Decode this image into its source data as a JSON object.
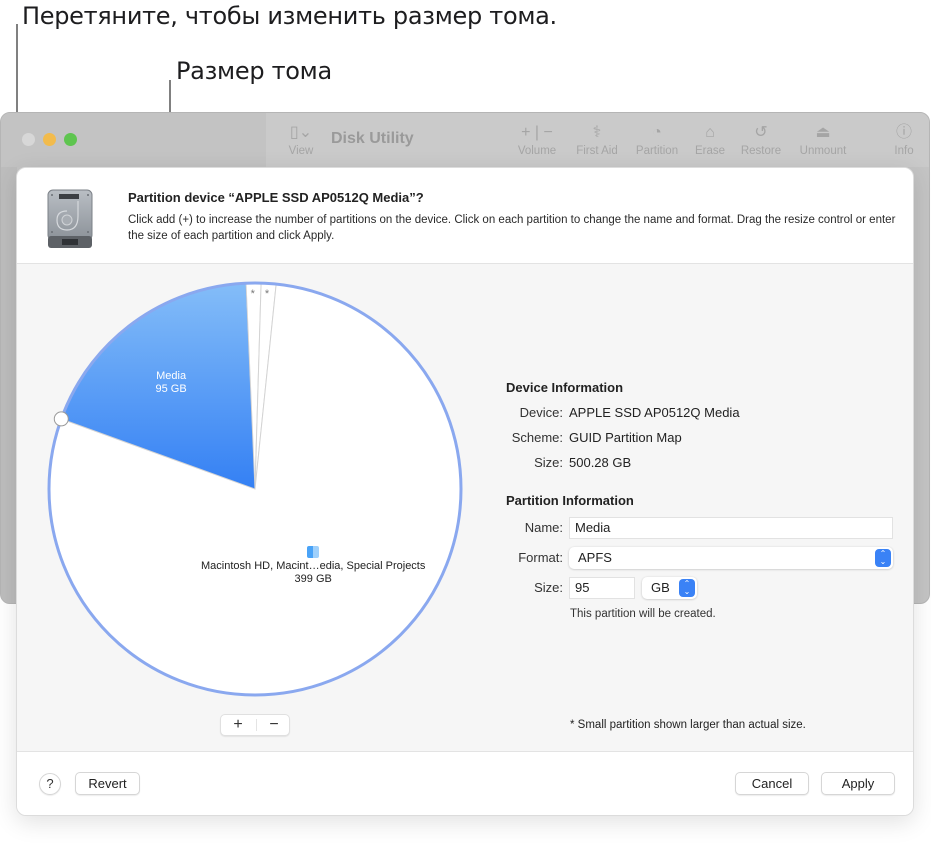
{
  "callouts": {
    "drag_hint": "Перетяните, чтобы изменить размер тома.",
    "volume_size": "Размер тома"
  },
  "window": {
    "title": "Disk Utility",
    "toolbar": [
      {
        "label": "View",
        "icon": "sidebar-toggle-icon"
      },
      {
        "label": "Volume",
        "icon": "plus-minus-icon"
      },
      {
        "label": "First Aid",
        "icon": "stethoscope-icon"
      },
      {
        "label": "Partition",
        "icon": "pie-chart-icon"
      },
      {
        "label": "Erase",
        "icon": "erase-disk-icon"
      },
      {
        "label": "Restore",
        "icon": "restore-arrow-icon"
      },
      {
        "label": "Unmount",
        "icon": "eject-icon"
      },
      {
        "label": "Info",
        "icon": "info-icon"
      }
    ]
  },
  "dialog": {
    "title": "Partition device “APPLE SSD AP0512Q Media”?",
    "description": "Click add (+) to increase the number of partitions on the device. Click on each partition to change the name and format. Drag the resize control or enter the size of each partition and click Apply.",
    "add_label": "+",
    "remove_label": "−",
    "footnote": "* Small partition shown larger than actual size.",
    "help_label": "?",
    "revert_label": "Revert",
    "cancel_label": "Cancel",
    "apply_label": "Apply"
  },
  "chart_data": {
    "type": "pie",
    "title": "",
    "unit": "GB",
    "slices": [
      {
        "name": "Media",
        "value": 95,
        "label": "95 GB",
        "selected": true,
        "color": "#3d87f5"
      },
      {
        "name": "small-partition-1",
        "value": 1,
        "label": "*",
        "selected": false,
        "color": "#ffffff"
      },
      {
        "name": "small-partition-2",
        "value": 1,
        "label": "*",
        "selected": false,
        "color": "#ffffff"
      },
      {
        "name": "Macintosh HD, Macint…edia, Special Projects",
        "value": 399,
        "label": "399 GB",
        "selected": false,
        "color": "#ffffff"
      }
    ],
    "outline_color": "#8aa8ef"
  },
  "device_info": {
    "heading": "Device Information",
    "device_label": "Device:",
    "device_value": "APPLE SSD AP0512Q Media",
    "scheme_label": "Scheme:",
    "scheme_value": "GUID Partition Map",
    "size_label": "Size:",
    "size_value": "500.28 GB"
  },
  "partition_info": {
    "heading": "Partition Information",
    "name_label": "Name:",
    "name_value": "Media",
    "format_label": "Format:",
    "format_value": "APFS",
    "size_label": "Size:",
    "size_value": "95",
    "size_unit": "GB",
    "status": "This partition will be created."
  },
  "colors": {
    "accent": "#3a82f6",
    "traffic_close": "#d7d7d7",
    "traffic_minimize": "#f2bb4c",
    "traffic_zoom": "#5ec54f"
  }
}
